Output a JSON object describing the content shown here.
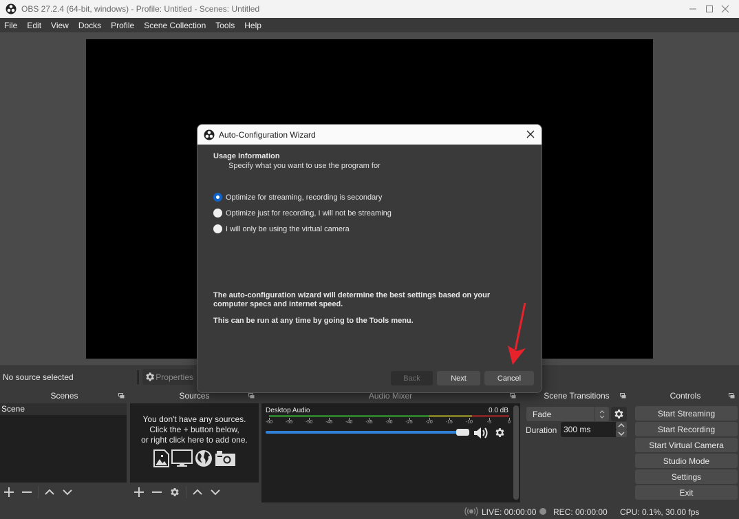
{
  "window": {
    "title": "OBS 27.2.4 (64-bit, windows) - Profile: Untitled - Scenes: Untitled",
    "minimize_icon": "minimize-icon",
    "maximize_icon": "maximize-icon",
    "close_icon": "close-icon"
  },
  "menu": [
    "File",
    "Edit",
    "View",
    "Docks",
    "Profile",
    "Scene Collection",
    "Tools",
    "Help"
  ],
  "source_bar": {
    "status": "No source selected",
    "properties_label": "Properties"
  },
  "docks": {
    "scenes": {
      "title": "Scenes",
      "items": [
        "Scene"
      ]
    },
    "sources": {
      "title": "Sources",
      "empty_lines": [
        "You don't have any sources.",
        "Click the + button below,",
        "or right click here to add one."
      ]
    },
    "audio_mixer": {
      "title": "Audio Mixer",
      "channel": {
        "name": "Desktop Audio",
        "level": "0.0 dB",
        "volume_percent": 100
      },
      "scale": [
        "-60",
        "-55",
        "-50",
        "-45",
        "-40",
        "-35",
        "-30",
        "-25",
        "-20",
        "-15",
        "-10",
        "-5",
        "0"
      ]
    },
    "transitions": {
      "title": "Scene Transitions",
      "selected": "Fade",
      "duration_label": "Duration",
      "duration_value": "300 ms"
    },
    "controls": {
      "title": "Controls",
      "buttons": [
        "Start Streaming",
        "Start Recording",
        "Start Virtual Camera",
        "Studio Mode",
        "Settings",
        "Exit"
      ]
    }
  },
  "status": {
    "live": "LIVE: 00:00:00",
    "rec": "REC: 00:00:00",
    "cpu": "CPU: 0.1%, 30.00 fps"
  },
  "dialog": {
    "title": "Auto-Configuration Wizard",
    "heading": "Usage Information",
    "subheading": "Specify what you want to use the program for",
    "options": [
      {
        "label": "Optimize for streaming, recording is secondary",
        "selected": true
      },
      {
        "label": "Optimize just for recording, I will not be streaming",
        "selected": false
      },
      {
        "label": "I will only be using the virtual camera",
        "selected": false
      }
    ],
    "info_line1": "The auto-configuration wizard will determine the best settings based on your",
    "info_line2": "computer specs and internet speed.",
    "info_line3": "This can be run at any time by going to the Tools menu.",
    "back_label": "Back",
    "next_label": "Next",
    "cancel_label": "Cancel"
  },
  "colors": {
    "accent": "#0f63c9",
    "annotation_arrow": "#e8222a",
    "meter_green": "#2d7d2d",
    "meter_yellow": "#7e7a26",
    "meter_red": "#7e2424",
    "slider": "#2f80d6"
  }
}
